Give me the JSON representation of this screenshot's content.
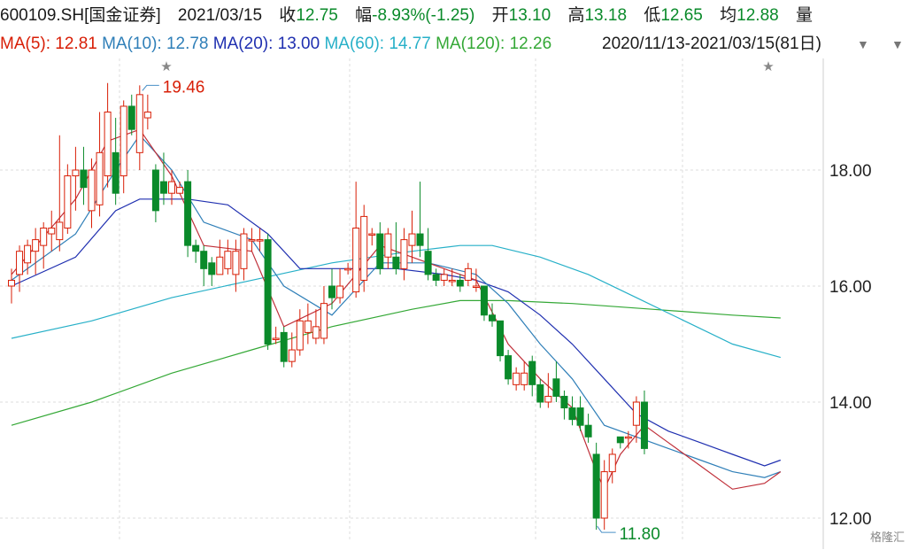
{
  "header": {
    "symbol": "600109.SH[国金证券]",
    "date": "2021/03/15",
    "close_label": "收",
    "close": "12.75",
    "change_label": "幅",
    "change": "-8.93%(-1.25)",
    "open_label": "开",
    "open": "13.10",
    "high_label": "高",
    "high": "13.18",
    "low_label": "低",
    "low": "12.65",
    "avg_label": "均",
    "avg": "12.88",
    "vol_label": "量"
  },
  "ma_legend": {
    "ma5": "MA(5): 12.81",
    "ma10": "MA(10): 12.78",
    "ma20": "MA(20): 13.00",
    "ma60": "MA(60): 14.77",
    "ma120": "MA(120): 12.26"
  },
  "range_text": "2020/11/13-2021/03/15(81日)",
  "icons": [
    "triangle-down-icon",
    "triangle-down-icon",
    "star-icon",
    "star-icon"
  ],
  "watermark": "格隆汇",
  "colors": {
    "up": "#d81e06",
    "down": "#0a8a2a",
    "ma5": "#c0303a",
    "ma10": "#2f7fb8",
    "ma20": "#1f2fb0",
    "ma60": "#27b0c8",
    "ma120": "#34a836"
  },
  "chart_data": {
    "type": "candlestick",
    "y_ticks": [
      "18.00",
      "16.00",
      "14.00",
      "12.00"
    ],
    "ylim": [
      11.6,
      19.9
    ],
    "grid": true,
    "annotations": {
      "high": "19.46",
      "low": "11.80"
    },
    "candles": [
      [
        16.0,
        16.1,
        15.7,
        16.3
      ],
      [
        16.2,
        16.6,
        15.9,
        16.7
      ],
      [
        16.4,
        16.7,
        16.2,
        16.8
      ],
      [
        16.6,
        16.8,
        16.2,
        17.0
      ],
      [
        16.7,
        17.0,
        16.3,
        17.1
      ],
      [
        16.9,
        17.0,
        16.6,
        17.3
      ],
      [
        16.8,
        17.1,
        16.6,
        18.6
      ],
      [
        17.0,
        17.9,
        16.9,
        18.1
      ],
      [
        17.9,
        18.0,
        17.3,
        18.4
      ],
      [
        18.0,
        17.7,
        17.4,
        18.4
      ],
      [
        17.3,
        18.0,
        17.0,
        18.2
      ],
      [
        17.4,
        18.3,
        17.2,
        19.0
      ],
      [
        17.9,
        19.0,
        17.7,
        19.5
      ],
      [
        18.3,
        17.6,
        17.4,
        18.9
      ],
      [
        17.9,
        19.1,
        17.6,
        19.2
      ],
      [
        19.1,
        18.7,
        18.6,
        19.3
      ],
      [
        18.3,
        19.3,
        18.0,
        19.46
      ],
      [
        18.9,
        19.0,
        18.7,
        19.3
      ],
      [
        18.0,
        17.3,
        17.1,
        18.1
      ],
      [
        17.8,
        17.6,
        17.4,
        18.3
      ],
      [
        17.6,
        17.8,
        17.4,
        18.0
      ],
      [
        17.6,
        17.7,
        17.6,
        17.8
      ],
      [
        17.8,
        16.7,
        16.5,
        18.0
      ],
      [
        16.7,
        16.6,
        16.4,
        16.8
      ],
      [
        16.6,
        16.3,
        16.0,
        16.7
      ],
      [
        16.4,
        16.2,
        16.0,
        16.5
      ],
      [
        16.2,
        16.5,
        16.2,
        16.8
      ],
      [
        16.3,
        16.6,
        16.2,
        16.8
      ],
      [
        16.2,
        16.6,
        15.9,
        16.8
      ],
      [
        16.3,
        16.9,
        16.1,
        17.0
      ],
      [
        16.8,
        16.8,
        16.6,
        17.0
      ],
      [
        16.8,
        16.8,
        16.6,
        17.0
      ],
      [
        16.8,
        15.0,
        14.9,
        16.9
      ],
      [
        15.1,
        15.1,
        15.0,
        15.3
      ],
      [
        15.2,
        14.7,
        14.6,
        15.3
      ],
      [
        14.7,
        14.9,
        14.6,
        15.2
      ],
      [
        14.9,
        15.4,
        14.8,
        15.6
      ],
      [
        15.2,
        15.4,
        15.0,
        15.7
      ],
      [
        15.1,
        15.3,
        15.0,
        15.6
      ],
      [
        15.1,
        15.7,
        15.0,
        16.0
      ],
      [
        16.0,
        15.8,
        15.6,
        16.3
      ],
      [
        15.8,
        16.0,
        15.7,
        16.3
      ],
      [
        16.3,
        16.3,
        16.2,
        16.4
      ],
      [
        15.9,
        17.0,
        15.8,
        17.8
      ],
      [
        16.1,
        17.2,
        15.9,
        17.4
      ],
      [
        16.9,
        16.9,
        16.7,
        17.0
      ],
      [
        16.9,
        16.3,
        16.2,
        17.1
      ],
      [
        16.5,
        16.9,
        16.3,
        17.0
      ],
      [
        16.5,
        16.3,
        16.2,
        17.1
      ],
      [
        16.3,
        16.8,
        16.1,
        17.0
      ],
      [
        16.7,
        16.9,
        16.4,
        17.3
      ],
      [
        16.9,
        16.7,
        16.5,
        17.8
      ],
      [
        16.6,
        16.2,
        16.1,
        17.0
      ],
      [
        16.2,
        16.1,
        16.0,
        16.3
      ],
      [
        16.1,
        16.2,
        16.0,
        16.3
      ],
      [
        16.1,
        16.1,
        16.0,
        16.3
      ],
      [
        16.1,
        16.0,
        15.9,
        16.2
      ],
      [
        16.1,
        16.3,
        16.0,
        16.4
      ],
      [
        16.0,
        16.0,
        15.9,
        16.3
      ],
      [
        16.0,
        15.5,
        15.4,
        16.0
      ],
      [
        15.5,
        15.4,
        15.3,
        15.7
      ],
      [
        15.4,
        14.8,
        14.7,
        15.4
      ],
      [
        14.8,
        14.4,
        14.3,
        14.9
      ],
      [
        14.3,
        14.5,
        14.2,
        14.6
      ],
      [
        14.3,
        14.5,
        14.2,
        14.7
      ],
      [
        14.7,
        14.3,
        14.1,
        14.8
      ],
      [
        14.3,
        14.0,
        13.9,
        14.4
      ],
      [
        14.0,
        14.1,
        13.9,
        14.5
      ],
      [
        14.4,
        14.1,
        14.0,
        14.7
      ],
      [
        14.1,
        13.9,
        13.7,
        14.2
      ],
      [
        13.9,
        13.7,
        13.6,
        14.1
      ],
      [
        13.9,
        13.6,
        13.5,
        14.1
      ],
      [
        13.6,
        13.4,
        13.3,
        13.8
      ],
      [
        13.1,
        12.0,
        11.8,
        13.3
      ],
      [
        12.0,
        12.8,
        11.8,
        13.0
      ],
      [
        12.8,
        13.1,
        12.6,
        13.2
      ],
      [
        13.4,
        13.3,
        13.2,
        13.4
      ],
      [
        13.4,
        13.4,
        13.2,
        13.5
      ],
      [
        13.6,
        14.0,
        13.3,
        14.1
      ],
      [
        14.0,
        13.2,
        13.1,
        14.2
      ]
    ],
    "ma5": [
      [
        0,
        16.2
      ],
      [
        8,
        17.5
      ],
      [
        12,
        18.5
      ],
      [
        16,
        18.7
      ],
      [
        20,
        17.9
      ],
      [
        24,
        16.7
      ],
      [
        30,
        16.6
      ],
      [
        34,
        15.3
      ],
      [
        40,
        15.7
      ],
      [
        46,
        16.7
      ],
      [
        52,
        16.4
      ],
      [
        58,
        16.1
      ],
      [
        62,
        15.0
      ],
      [
        66,
        14.4
      ],
      [
        70,
        13.9
      ],
      [
        73,
        12.8
      ],
      [
        74,
        12.5
      ],
      [
        76,
        13.1
      ],
      [
        79,
        13.6
      ],
      [
        82,
        13.3
      ],
      [
        86,
        12.9
      ],
      [
        90,
        12.5
      ],
      [
        94,
        12.6
      ],
      [
        96,
        12.8
      ]
    ],
    "ma10": [
      [
        0,
        16.1
      ],
      [
        8,
        16.9
      ],
      [
        13,
        18.0
      ],
      [
        16,
        18.6
      ],
      [
        20,
        18.0
      ],
      [
        24,
        17.1
      ],
      [
        30,
        16.8
      ],
      [
        34,
        16.0
      ],
      [
        40,
        15.5
      ],
      [
        46,
        16.4
      ],
      [
        52,
        16.4
      ],
      [
        58,
        16.2
      ],
      [
        62,
        15.7
      ],
      [
        66,
        15.0
      ],
      [
        70,
        14.4
      ],
      [
        74,
        13.6
      ],
      [
        78,
        13.4
      ],
      [
        82,
        13.2
      ],
      [
        86,
        13.0
      ],
      [
        90,
        12.8
      ],
      [
        94,
        12.7
      ],
      [
        96,
        12.8
      ]
    ],
    "ma20": [
      [
        0,
        16.0
      ],
      [
        8,
        16.5
      ],
      [
        13,
        17.3
      ],
      [
        16,
        17.5
      ],
      [
        22,
        17.5
      ],
      [
        27,
        17.4
      ],
      [
        32,
        16.9
      ],
      [
        36,
        16.3
      ],
      [
        42,
        16.3
      ],
      [
        48,
        16.3
      ],
      [
        54,
        16.2
      ],
      [
        58,
        16.1
      ],
      [
        62,
        15.9
      ],
      [
        66,
        15.5
      ],
      [
        70,
        15.0
      ],
      [
        74,
        14.4
      ],
      [
        78,
        13.8
      ],
      [
        82,
        13.5
      ],
      [
        86,
        13.3
      ],
      [
        90,
        13.1
      ],
      [
        94,
        12.9
      ],
      [
        96,
        13.0
      ]
    ],
    "ma60": [
      [
        0,
        15.1
      ],
      [
        10,
        15.4
      ],
      [
        20,
        15.8
      ],
      [
        30,
        16.1
      ],
      [
        40,
        16.4
      ],
      [
        50,
        16.6
      ],
      [
        56,
        16.7
      ],
      [
        60,
        16.7
      ],
      [
        66,
        16.5
      ],
      [
        72,
        16.2
      ],
      [
        78,
        15.8
      ],
      [
        84,
        15.4
      ],
      [
        90,
        15.0
      ],
      [
        96,
        14.77
      ]
    ],
    "ma120": [
      [
        0,
        13.6
      ],
      [
        10,
        14.0
      ],
      [
        20,
        14.5
      ],
      [
        30,
        14.9
      ],
      [
        40,
        15.3
      ],
      [
        50,
        15.6
      ],
      [
        56,
        15.75
      ],
      [
        62,
        15.75
      ],
      [
        70,
        15.7
      ],
      [
        80,
        15.6
      ],
      [
        90,
        15.5
      ],
      [
        96,
        15.45
      ]
    ]
  }
}
